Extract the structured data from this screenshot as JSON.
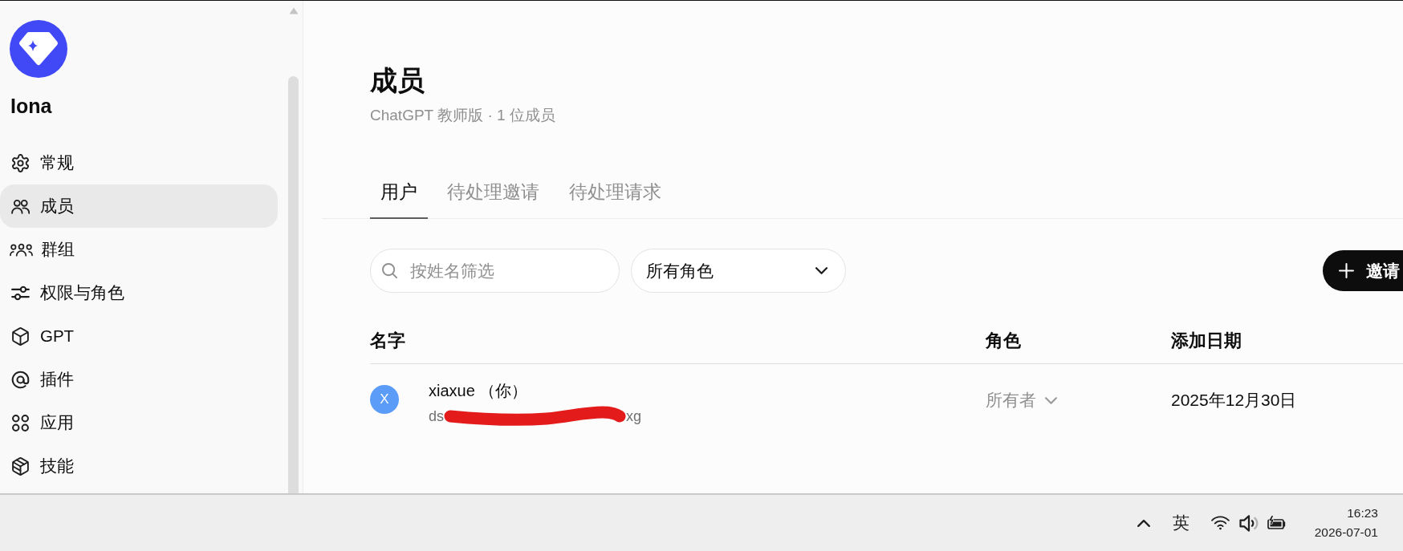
{
  "sidebar": {
    "workspace_name": "Iona",
    "items": [
      {
        "label": "常规",
        "selected": false
      },
      {
        "label": "成员",
        "selected": true
      },
      {
        "label": "群组",
        "selected": false
      },
      {
        "label": "权限与角色",
        "selected": false
      },
      {
        "label": "GPT",
        "selected": false
      },
      {
        "label": "插件",
        "selected": false
      },
      {
        "label": "应用",
        "selected": false
      },
      {
        "label": "技能",
        "selected": false
      }
    ]
  },
  "header": {
    "title": "成员",
    "subtitle": "ChatGPT 教师版 · 1 位成员"
  },
  "tabs": [
    {
      "label": "用户",
      "selected": true
    },
    {
      "label": "待处理邀请",
      "selected": false
    },
    {
      "label": "待处理请求",
      "selected": false
    }
  ],
  "toolbar": {
    "search": {
      "placeholder": "按姓名筛选"
    },
    "role_filter": {
      "value": "所有角色"
    },
    "invite_button": {
      "label": "邀请"
    }
  },
  "table": {
    "columns": [
      "名字",
      "角色",
      "添加日期"
    ],
    "rows": [
      {
        "avatar": "X",
        "name": "xiaxue （你）",
        "email_start": "ds",
        "email_end": "xg",
        "role": "所有者",
        "date_added": "2025年12月30日"
      }
    ]
  },
  "taskbar": {
    "input_method": "英",
    "time": "16:23",
    "date": "2026-07-01"
  }
}
